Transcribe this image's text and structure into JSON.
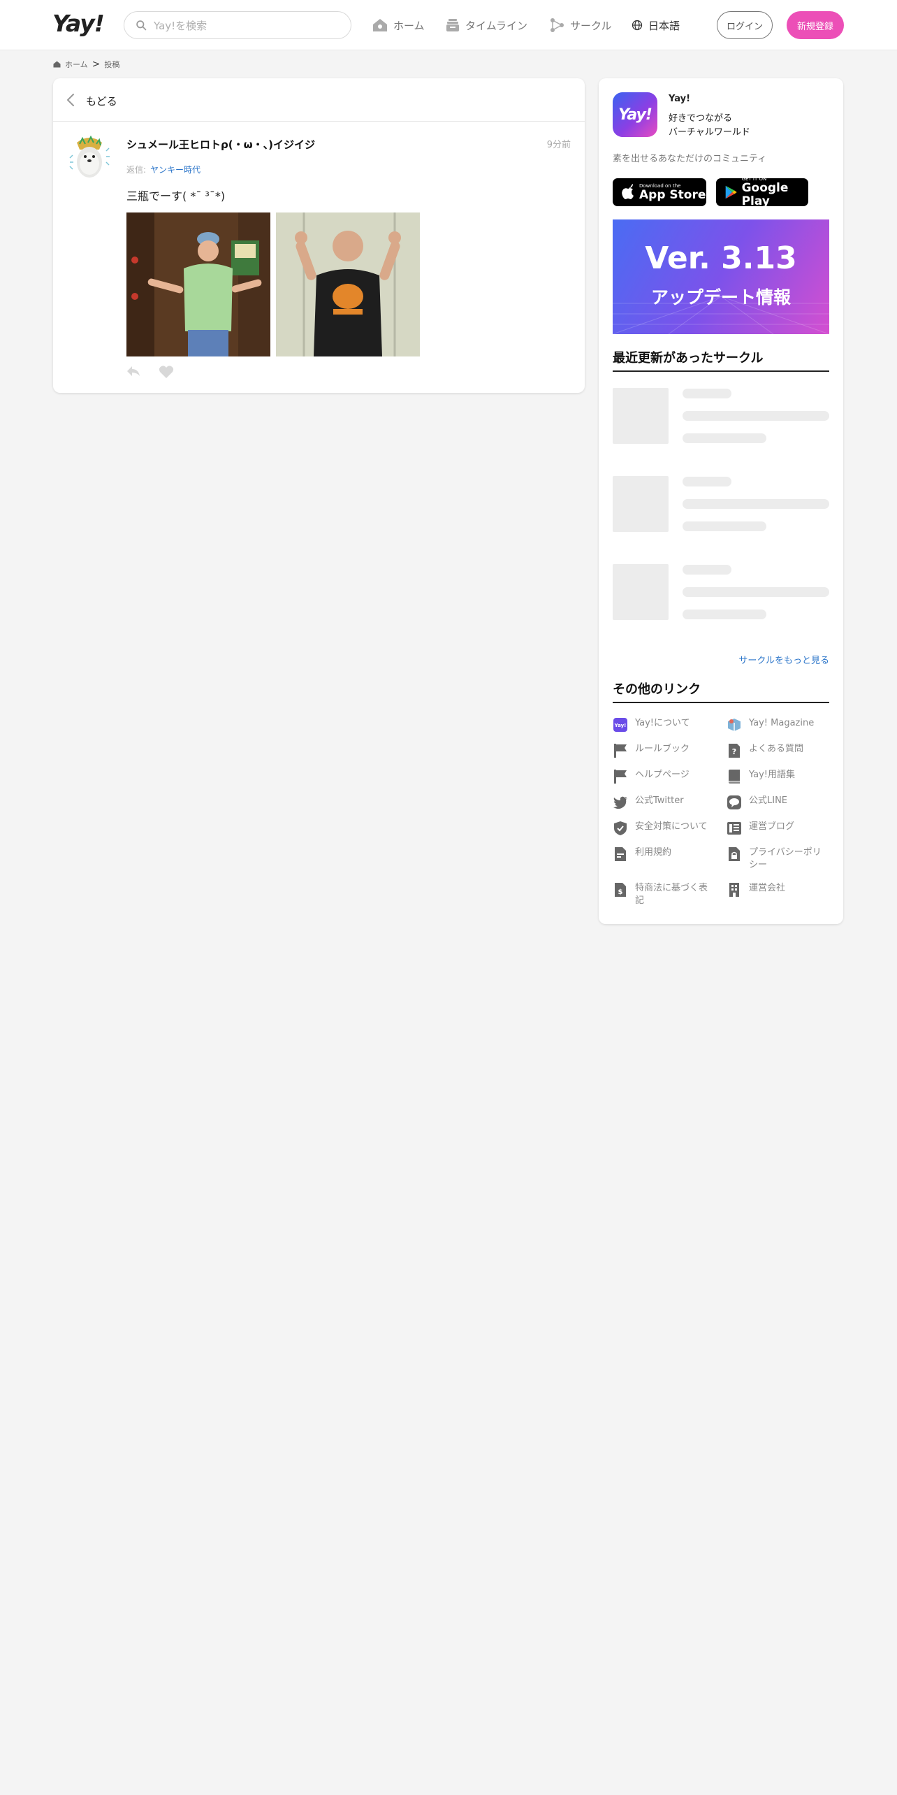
{
  "header": {
    "logo": "Yay!",
    "search_placeholder": "Yay!を検索",
    "nav": {
      "home": "ホーム",
      "timeline": "タイムライン",
      "circle": "サークル",
      "language": "日本語"
    },
    "login_label": "ログイン",
    "signup_label": "新規登録",
    "accent_color": "#ec4fb7"
  },
  "breadcrumb": {
    "home": "ホーム",
    "separator": ">",
    "current": "投稿"
  },
  "post": {
    "back_label": "もどる",
    "author": "シュメール王ヒロトρ(・ω・、)イジイジ",
    "time": "9分前",
    "reply_prefix": "返信:",
    "reply_target": "ヤンキー時代",
    "text": "三瓶でーす( *¯ ³¯*)"
  },
  "sidebar": {
    "app_name": "Yay!",
    "tagline_1": "好きでつながる",
    "tagline_2": "バーチャルワールド",
    "description": "素を出せるあなただけのコミュニティ",
    "appstore_small": "Download on the",
    "appstore_big": "App Store",
    "googleplay_small": "GET IT ON",
    "googleplay_big": "Google Play",
    "banner_version": "Ver. 3.13",
    "banner_sub": "アップデート情報",
    "circles_title": "最近更新があったサークル",
    "circles_more": "サークルをもっと見る",
    "links_title": "その他のリンク",
    "links": [
      {
        "label": "Yay!について",
        "icon": "yay-icon"
      },
      {
        "label": "Yay! Magazine",
        "icon": "magazine-icon"
      },
      {
        "label": "ルールブック",
        "icon": "flag-icon"
      },
      {
        "label": "よくある質問",
        "icon": "question-icon"
      },
      {
        "label": "ヘルプページ",
        "icon": "flag-icon"
      },
      {
        "label": "Yay!用語集",
        "icon": "book-icon"
      },
      {
        "label": "公式Twitter",
        "icon": "twitter-icon"
      },
      {
        "label": "公式LINE",
        "icon": "line-icon"
      },
      {
        "label": "安全対策について",
        "icon": "shield-icon"
      },
      {
        "label": "運営ブログ",
        "icon": "blog-icon"
      },
      {
        "label": "利用規約",
        "icon": "document-icon"
      },
      {
        "label": "プライバシーポリシー",
        "icon": "lock-document-icon"
      },
      {
        "label": "特商法に基づく表記",
        "icon": "dollar-document-icon"
      },
      {
        "label": "運営会社",
        "icon": "building-icon"
      }
    ]
  }
}
